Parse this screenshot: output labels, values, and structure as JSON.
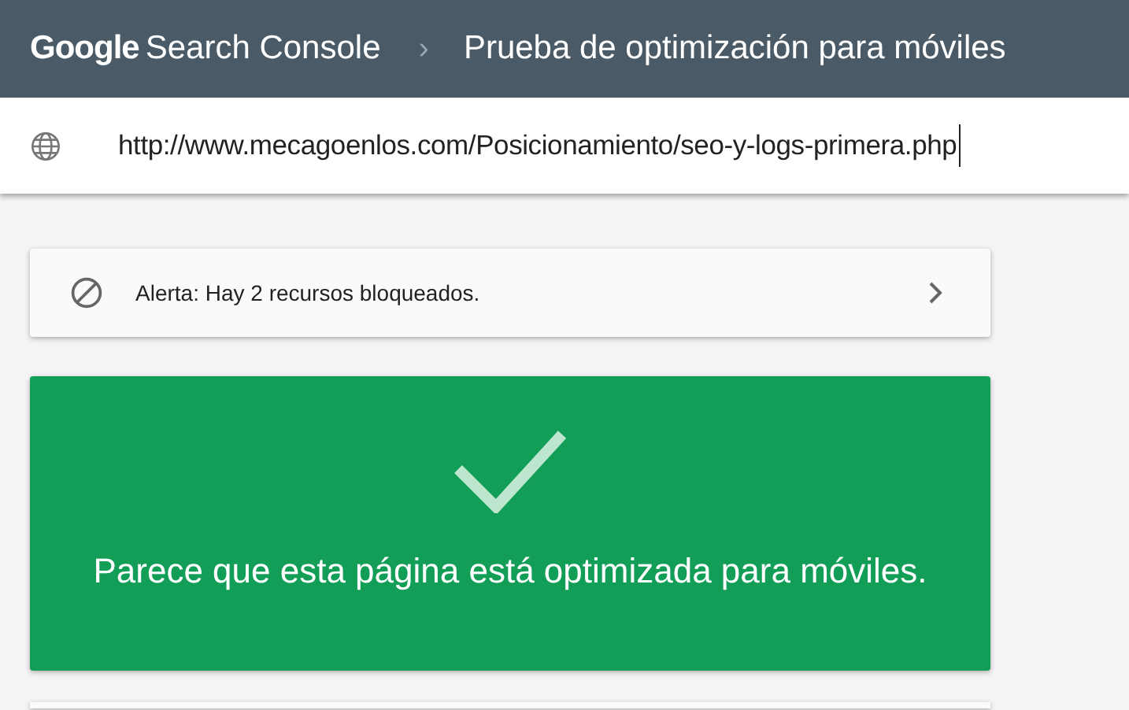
{
  "header": {
    "logo_word": "Google",
    "product": "Search Console",
    "separator": "›",
    "title": "Prueba de optimización para móviles"
  },
  "url_field": {
    "value": "http://www.mecagoenlos.com/Posicionamiento/seo-y-logs-primera.php"
  },
  "alert": {
    "text": "Alerta: Hay 2 recursos bloqueados."
  },
  "result": {
    "passed": true,
    "message": "Parece que esta página está optimizada para móviles."
  }
}
